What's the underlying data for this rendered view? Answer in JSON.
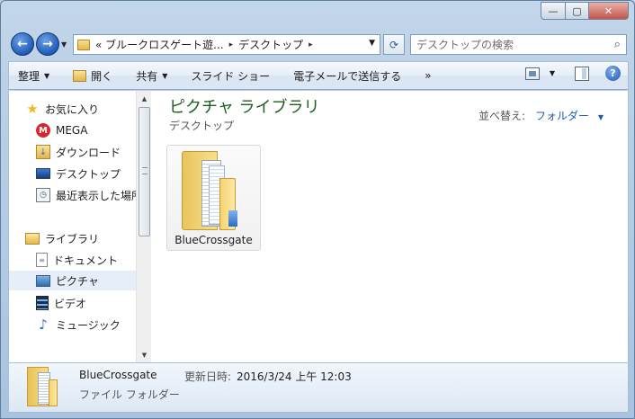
{
  "window": {
    "caption_min": "—",
    "caption_max": "▢",
    "caption_close": "✕"
  },
  "nav": {
    "back": "←",
    "forward": "→",
    "dropdown": "▼"
  },
  "address": {
    "overflow": "«",
    "segments": [
      "ブルークロスゲート遊...",
      "デスクトップ"
    ],
    "separator": "▸",
    "dropdown": "▼",
    "refresh": "⟳"
  },
  "search": {
    "placeholder": "デスクトップの検索",
    "icon": "search-icon"
  },
  "toolbar": {
    "organize": "整理",
    "open": "開く",
    "share": "共有",
    "slideshow": "スライド ショー",
    "email": "電子メールで送信する",
    "more": "»",
    "arrow": "▼",
    "help": "?"
  },
  "sidebar": {
    "items": [
      {
        "label": "お気に入り",
        "icon": "star-icon"
      },
      {
        "label": "MEGA",
        "icon": "mega-icon"
      },
      {
        "label": "ダウンロード",
        "icon": "download-folder-icon"
      },
      {
        "label": "デスクトップ",
        "icon": "desktop-icon"
      },
      {
        "label": "最近表示した場所",
        "icon": "recent-places-icon"
      },
      {
        "label": "ライブラリ",
        "icon": "library-icon"
      },
      {
        "label": "ドキュメント",
        "icon": "document-icon"
      },
      {
        "label": "ピクチャ",
        "icon": "picture-icon",
        "selected": true
      },
      {
        "label": "ビデオ",
        "icon": "video-icon"
      },
      {
        "label": "ミュージック",
        "icon": "music-icon"
      }
    ],
    "scroll_up": "▲",
    "scroll_down": "▼"
  },
  "main": {
    "title": "ピクチャ ライブラリ",
    "subtitle": "デスクトップ",
    "arrange_label": "並べ替え:",
    "arrange_value": "フォルダー",
    "arrange_arrow": "▼",
    "items": [
      {
        "name": "BlueCrossgate",
        "icon": "folder-icon"
      }
    ]
  },
  "details": {
    "name": "BlueCrossgate",
    "type": "ファイル フォルダー",
    "modified_label": "更新日時:",
    "modified_value": "2016/3/24 上午 12:03"
  }
}
